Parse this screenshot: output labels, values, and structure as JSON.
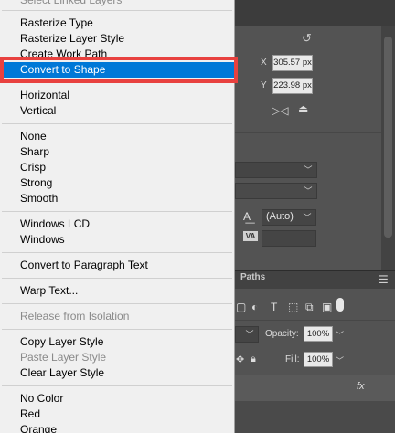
{
  "menu": {
    "items": [
      {
        "label": "Select Linked Layers",
        "disabled": true
      },
      {
        "label": "Rasterize Type"
      },
      {
        "label": "Rasterize Layer Style"
      },
      {
        "label": "Create Work Path"
      },
      {
        "label": "Convert to Shape",
        "selected": true
      },
      {
        "label": "Horizontal"
      },
      {
        "label": "Vertical"
      },
      {
        "label": "None"
      },
      {
        "label": "Sharp"
      },
      {
        "label": "Crisp"
      },
      {
        "label": "Strong"
      },
      {
        "label": "Smooth"
      },
      {
        "label": "Windows LCD"
      },
      {
        "label": "Windows"
      },
      {
        "label": "Convert to Paragraph Text"
      },
      {
        "label": "Warp Text..."
      },
      {
        "label": "Release from Isolation",
        "disabled": true
      },
      {
        "label": "Copy Layer Style"
      },
      {
        "label": "Paste Layer Style",
        "disabled": true
      },
      {
        "label": "Clear Layer Style"
      },
      {
        "label": "No Color"
      },
      {
        "label": "Red"
      },
      {
        "label": "Orange"
      }
    ]
  },
  "properties": {
    "x_label": "X",
    "x_value": "305.57 px",
    "y_label": "Y",
    "y_value": "223.98 px",
    "leading_value": "(Auto)",
    "tracking_icon_label": "VA"
  },
  "layers_panel": {
    "tab_paths": "Paths",
    "opacity_label": "Opacity:",
    "opacity_value": "100%",
    "fill_label": "Fill:",
    "fill_value": "100%",
    "fx_label": "fx"
  },
  "colors": {
    "selection": "#0078d7",
    "highlight_border": "#e8413f",
    "menu_bg": "#f0f0f0",
    "panel_bg": "#535353"
  }
}
